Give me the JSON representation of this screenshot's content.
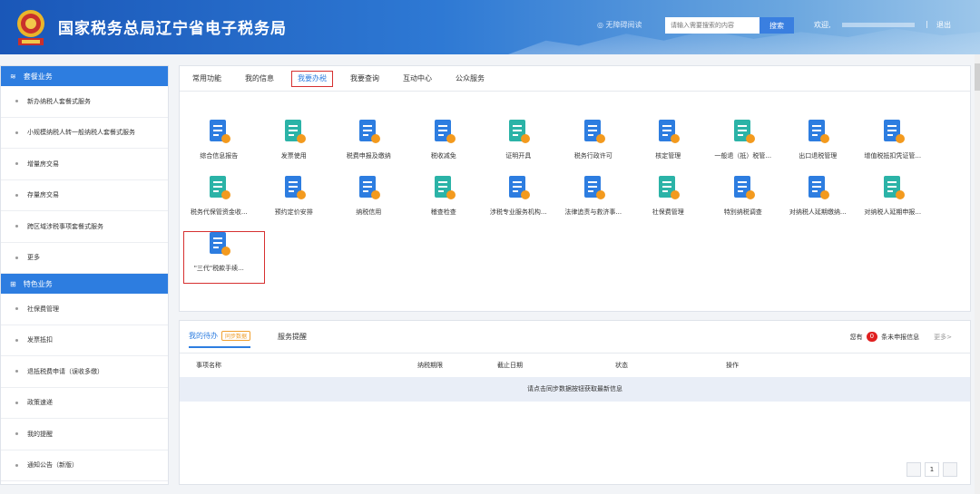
{
  "header": {
    "title": "国家税务总局辽宁省电子税务局",
    "accessible_label": "无障碍阅读",
    "search_placeholder": "请输入需要搜索的内容",
    "search_button": "搜索",
    "welcome": "欢迎,",
    "separator": "|",
    "logout": "退出"
  },
  "sidebar": {
    "package_section": "套餐业务",
    "package_items": [
      "新办纳税人套餐式服务",
      "小规模纳税人转一般纳税人套餐式服务",
      "增量房交易",
      "存量房交易",
      "跨区域涉税事项套餐式服务",
      "更多"
    ],
    "feature_section": "特色业务",
    "feature_items": [
      "社保费管理",
      "发票抵扣",
      "退抵税费申请（误收多缴）",
      "政策速递",
      "我的提醒",
      "通知公告（新版）"
    ]
  },
  "tabs": [
    "常用功能",
    "我的信息",
    "我要办税",
    "我要查询",
    "互动中心",
    "公众服务"
  ],
  "active_tab": 2,
  "services": [
    {
      "label": "综合信息报告",
      "icon": "report-icon"
    },
    {
      "label": "发票使用",
      "icon": "invoice-icon"
    },
    {
      "label": "税费申报及缴纳",
      "icon": "tax-pay-icon"
    },
    {
      "label": "税收减免",
      "icon": "reduction-icon"
    },
    {
      "label": "证明开具",
      "icon": "certificate-icon"
    },
    {
      "label": "税务行政许可",
      "icon": "license-icon"
    },
    {
      "label": "核定管理",
      "icon": "assessment-icon"
    },
    {
      "label": "一般退（抵）税管...",
      "icon": "refund-icon"
    },
    {
      "label": "出口退税管理",
      "icon": "export-refund-icon"
    },
    {
      "label": "增值税抵扣凭证管...",
      "icon": "vat-voucher-icon"
    },
    {
      "label": "税务代保管资金收...",
      "icon": "custody-funds-icon"
    },
    {
      "label": "预约定价安排",
      "icon": "pricing-icon"
    },
    {
      "label": "纳税信用",
      "icon": "credit-icon"
    },
    {
      "label": "稽查检查",
      "icon": "inspection-icon"
    },
    {
      "label": "涉税专业服务机构...",
      "icon": "agency-icon"
    },
    {
      "label": "法律追责与救济事...",
      "icon": "legal-icon"
    },
    {
      "label": "社保费管理",
      "icon": "social-security-icon"
    },
    {
      "label": "特別纳税调查",
      "icon": "special-investigation-icon"
    },
    {
      "label": "对纳税人延期缴纳...",
      "icon": "deferral-pay-icon"
    },
    {
      "label": "对纳税人延期申报...",
      "icon": "deferral-declare-icon"
    },
    {
      "label": "\"三代\"税款手续...",
      "icon": "fee-refund-icon"
    }
  ],
  "colors": {
    "primary": "#2d7de0",
    "highlight": "#d63030",
    "icon_blue": "#2d7de0",
    "icon_teal": "#2bb3a7",
    "icon_orange": "#f39a1e"
  },
  "todo": {
    "tab_todo": "我的待办",
    "sync_label": "同步数据",
    "tab_remind": "服务提醒",
    "you_have": "您有",
    "count": "0",
    "unreported": "条未申报信息",
    "more": "更多>",
    "columns": [
      "事项名称",
      "纳税期限",
      "截止日期",
      "状态",
      "操作"
    ],
    "empty": "请点击同步数据按钮获取最新信息"
  },
  "pager": {
    "current": "1"
  }
}
